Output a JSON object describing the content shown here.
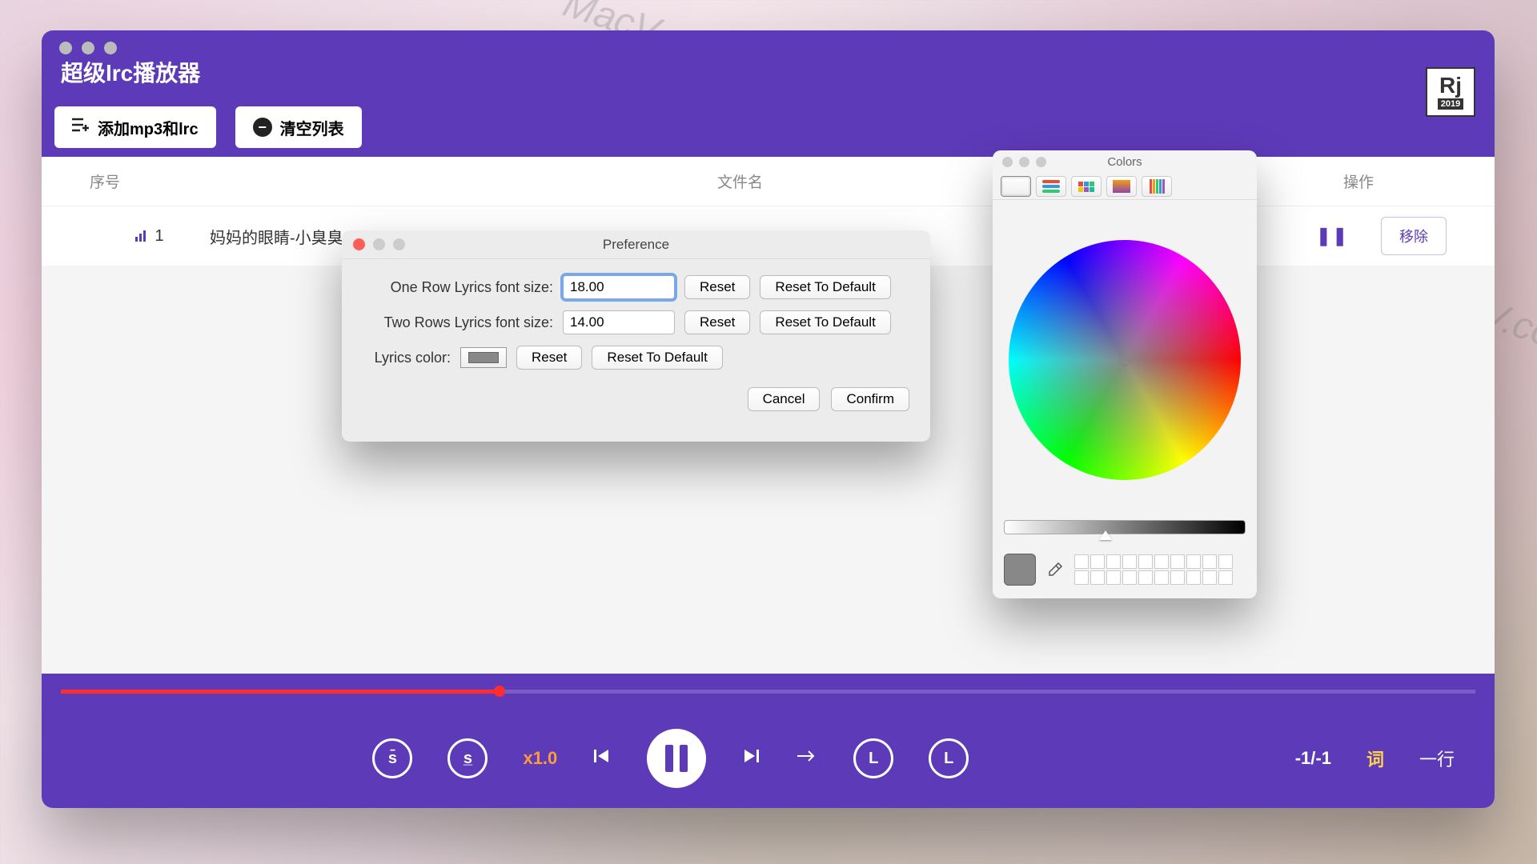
{
  "app": {
    "title": "超级lrc播放器",
    "logo": {
      "initials": "Rj",
      "year": "2019"
    }
  },
  "toolbar": {
    "add_label": "添加mp3和lrc",
    "clear_label": "清空列表"
  },
  "table": {
    "headers": {
      "seq": "序号",
      "file": "文件名",
      "op": "操作"
    },
    "rows": [
      {
        "seq": "1",
        "file": "妈妈的眼睛-小臭臭.m",
        "remove": "移除"
      }
    ]
  },
  "player": {
    "speed": "x1.0",
    "position": "-1/-1",
    "word": "词",
    "row_mode": "一行"
  },
  "pref": {
    "title": "Preference",
    "one_row_label": "One Row Lyrics font size:",
    "one_row_value": "18.00",
    "two_row_label": "Two Rows Lyrics font size:",
    "two_row_value": "14.00",
    "color_label": "Lyrics color:",
    "reset": "Reset",
    "reset_default": "Reset To Default",
    "cancel": "Cancel",
    "confirm": "Confirm"
  },
  "colors": {
    "title": "Colors"
  },
  "watermarks": {
    "text": "MacV.com"
  }
}
